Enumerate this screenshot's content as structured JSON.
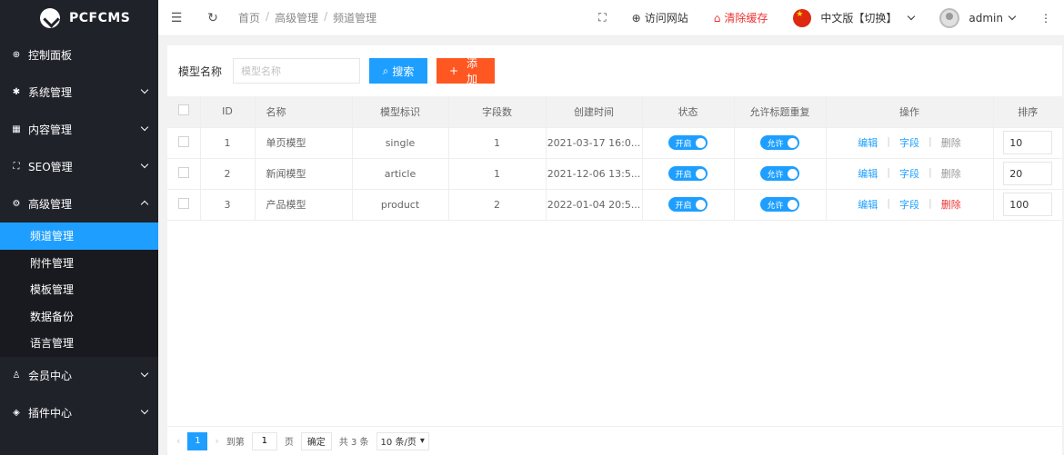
{
  "brand": {
    "name": "PCFCMS"
  },
  "sidebar": {
    "items": [
      {
        "label": "控制面板",
        "icon": "globe-icon",
        "expanded": false,
        "has_arrow": false
      },
      {
        "label": "系统管理",
        "icon": "gear-icon",
        "expanded": false,
        "has_arrow": true
      },
      {
        "label": "内容管理",
        "icon": "grid-icon",
        "expanded": false,
        "has_arrow": true
      },
      {
        "label": "SEO管理",
        "icon": "seo-icon",
        "expanded": false,
        "has_arrow": true
      },
      {
        "label": "高级管理",
        "icon": "cog-icon",
        "expanded": true,
        "has_arrow": true
      },
      {
        "label": "会员中心",
        "icon": "user-icon",
        "expanded": false,
        "has_arrow": true
      },
      {
        "label": "插件中心",
        "icon": "layers-icon",
        "expanded": false,
        "has_arrow": true
      }
    ],
    "sub_items": [
      "频道管理",
      "附件管理",
      "模板管理",
      "数据备份",
      "语言管理"
    ],
    "active_sub": "频道管理"
  },
  "header": {
    "breadcrumb": [
      "首页",
      "高级管理",
      "频道管理"
    ],
    "visit_site": "访问网站",
    "clear_cache": "清除缓存",
    "language": "中文版【切换】",
    "user": "admin"
  },
  "search": {
    "label": "模型名称",
    "placeholder": "模型名称",
    "search_button": "搜索",
    "add_button": "添加"
  },
  "table": {
    "columns": [
      "ID",
      "名称",
      "模型标识",
      "字段数",
      "创建时间",
      "状态",
      "允许标题重复",
      "操作",
      "排序"
    ],
    "rows": [
      {
        "id": "1",
        "name": "单页模型",
        "ident": "single",
        "fields": "1",
        "created": "2021-03-17 16:0...",
        "status": "开启",
        "allow_dup": "允许",
        "sort": "10",
        "delete_red": false
      },
      {
        "id": "2",
        "name": "新闻模型",
        "ident": "article",
        "fields": "1",
        "created": "2021-12-06 13:5...",
        "status": "开启",
        "allow_dup": "允许",
        "sort": "20",
        "delete_red": false
      },
      {
        "id": "3",
        "name": "产品模型",
        "ident": "product",
        "fields": "2",
        "created": "2022-01-04 20:5...",
        "status": "开启",
        "allow_dup": "允许",
        "sort": "100",
        "delete_red": true
      }
    ],
    "ops": {
      "edit": "编辑",
      "fields": "字段",
      "delete": "删除"
    }
  },
  "pager": {
    "current_page": "1",
    "goto_label": "到第",
    "goto_value": "1",
    "page_unit": "页",
    "confirm": "确定",
    "total": "共 3 条",
    "page_size": "10 条/页"
  },
  "colors": {
    "primary": "#1e9fff",
    "danger": "#ff5722",
    "sidebar": "#20222a",
    "red_text": "#ee3333"
  }
}
